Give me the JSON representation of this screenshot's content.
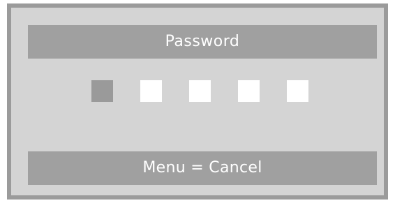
{
  "dialog": {
    "title": "Password",
    "hint": "Menu = Cancel",
    "pin": {
      "length": 5,
      "active_index": 0,
      "colors": {
        "active": "#9a9a9a",
        "empty": "#ffffff"
      }
    }
  },
  "colors": {
    "dialog_background": "#d4d4d4",
    "dialog_border": "#9b9b9b",
    "bar_background": "#a0a0a0",
    "bar_text": "#ffffff"
  }
}
